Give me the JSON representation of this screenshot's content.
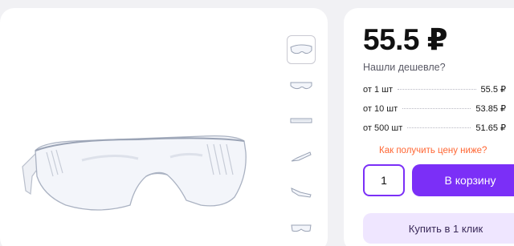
{
  "gallery": {
    "main_image_alt": "glasses-image",
    "thumbnails": [
      "glasses-front",
      "glasses-front-2",
      "glasses-top",
      "glasses-side",
      "glasses-angle",
      "glasses-back"
    ]
  },
  "buy": {
    "price": "55.5 ₽",
    "cheaper_link": "Нашли дешевле?",
    "tiers": [
      {
        "qty": "от 1 шт",
        "price": "55.5 ₽"
      },
      {
        "qty": "от 10 шт",
        "price": "53.85 ₽"
      },
      {
        "qty": "от 500 шт",
        "price": "51.65 ₽"
      }
    ],
    "how_link": "Как получить цену ниже?",
    "quantity": "1",
    "cart_button": "В корзину",
    "one_click_button": "Купить в 1 клик"
  },
  "colors": {
    "accent": "#7b2ff7",
    "accent_light": "#efe6ff",
    "link_orange": "#ff6633"
  }
}
